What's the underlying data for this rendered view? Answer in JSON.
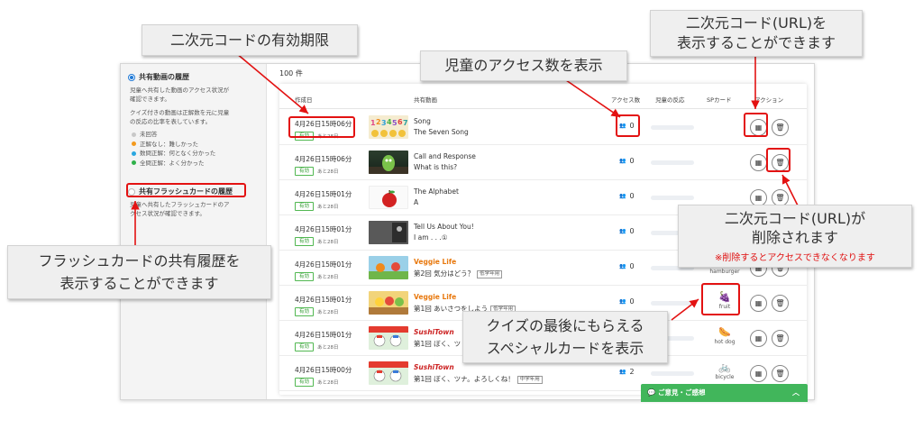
{
  "callouts": {
    "expiry": "二次元コードの有効期限",
    "access_count": "児童のアクセス数を表示",
    "qr_show_1": "二次元コード(URL)を",
    "qr_show_2": "表示することができます",
    "qr_delete_1": "二次元コード(URL)が",
    "qr_delete_2": "削除されます",
    "qr_delete_note": "※削除するとアクセスできなくなります",
    "flashcard_1": "フラッシュカードの共有履歴を",
    "flashcard_2": "表示することができます",
    "special_1": "クイズの最後にもらえる",
    "special_2": "スペシャルカードを表示"
  },
  "sidebar": {
    "section1_title": "共有動画の履歴",
    "section1_desc1": "児童へ共有した動画のアクセス状況が",
    "section1_desc2": "確認できます。",
    "section1_desc3": "クイズ付きの動画は正解数を元に児童",
    "section1_desc4": "の反応の比率を表しています。",
    "legend": [
      {
        "label": "未回答",
        "color": "#c8c8c8"
      },
      {
        "label": "正解なし：難しかった",
        "color": "#f39a1e"
      },
      {
        "label": "数問正解：何となく分かった",
        "color": "#2aa7e0"
      },
      {
        "label": "全問正解：よく分かった",
        "color": "#2fb14a"
      }
    ],
    "section2_title": "共有フラッシュカードの履歴",
    "section2_desc1": "児童へ共有したフラッシュカードのア",
    "section2_desc2": "クセス状況が確認できます。"
  },
  "main": {
    "count": "100 件",
    "headers": {
      "created": "作成日",
      "video": "共有動画",
      "access": "アクセス数",
      "reaction": "児童の反応",
      "sp_card": "SPカード",
      "action": "アクション"
    }
  },
  "rows": [
    {
      "date": "4月26日15時06分",
      "badge": "有効",
      "remain": "あと28日",
      "title": "Song",
      "sub": "The Seven Song",
      "access": "0",
      "card_name": ""
    },
    {
      "date": "4月26日15時06分",
      "badge": "有効",
      "remain": "あと28日",
      "title": "Call and Response",
      "sub": "What is this?",
      "access": "0",
      "card_name": ""
    },
    {
      "date": "4月26日15時01分",
      "badge": "有効",
      "remain": "あと28日",
      "title": "The Alphabet",
      "sub": "A",
      "access": "0",
      "card_name": ""
    },
    {
      "date": "4月26日15時01分",
      "badge": "有効",
      "remain": "あと28日",
      "title": "Tell Us About You!",
      "sub": "I am . . .①",
      "access": "0",
      "card_name": ""
    },
    {
      "date": "4月26日15時01分",
      "badge": "有効",
      "remain": "あと28日",
      "title": "Veggie Life",
      "sub": "第2回 気分はどう？",
      "grade": "低学年用",
      "access": "0",
      "card_name": "hamburger"
    },
    {
      "date": "4月26日15時01分",
      "badge": "有効",
      "remain": "あと28日",
      "title": "Veggie Life",
      "sub": "第1回 あいさつをしよう",
      "grade": "低学年用",
      "access": "0",
      "card_name": "fruit"
    },
    {
      "date": "4月26日15時01分",
      "badge": "有効",
      "remain": "あと28日",
      "title": "SushiTown",
      "sub": "第1回 ぼく、ツ",
      "access": "0",
      "card_name": "hot dog"
    },
    {
      "date": "4月26日15時00分",
      "badge": "有効",
      "remain": "あと28日",
      "title": "SushiTown",
      "sub": "第1回 ぼく、ツナ。よろしくね！",
      "grade": "中学年用",
      "access": "2",
      "card_name": "bicycle"
    }
  ],
  "feedback": {
    "label": "ご意見・ご感想"
  },
  "colors": {
    "highlight": "#e31212",
    "badge_green": "#2f9b2f",
    "feedback_green": "#41b65b",
    "title_orange": "#e8790f"
  }
}
